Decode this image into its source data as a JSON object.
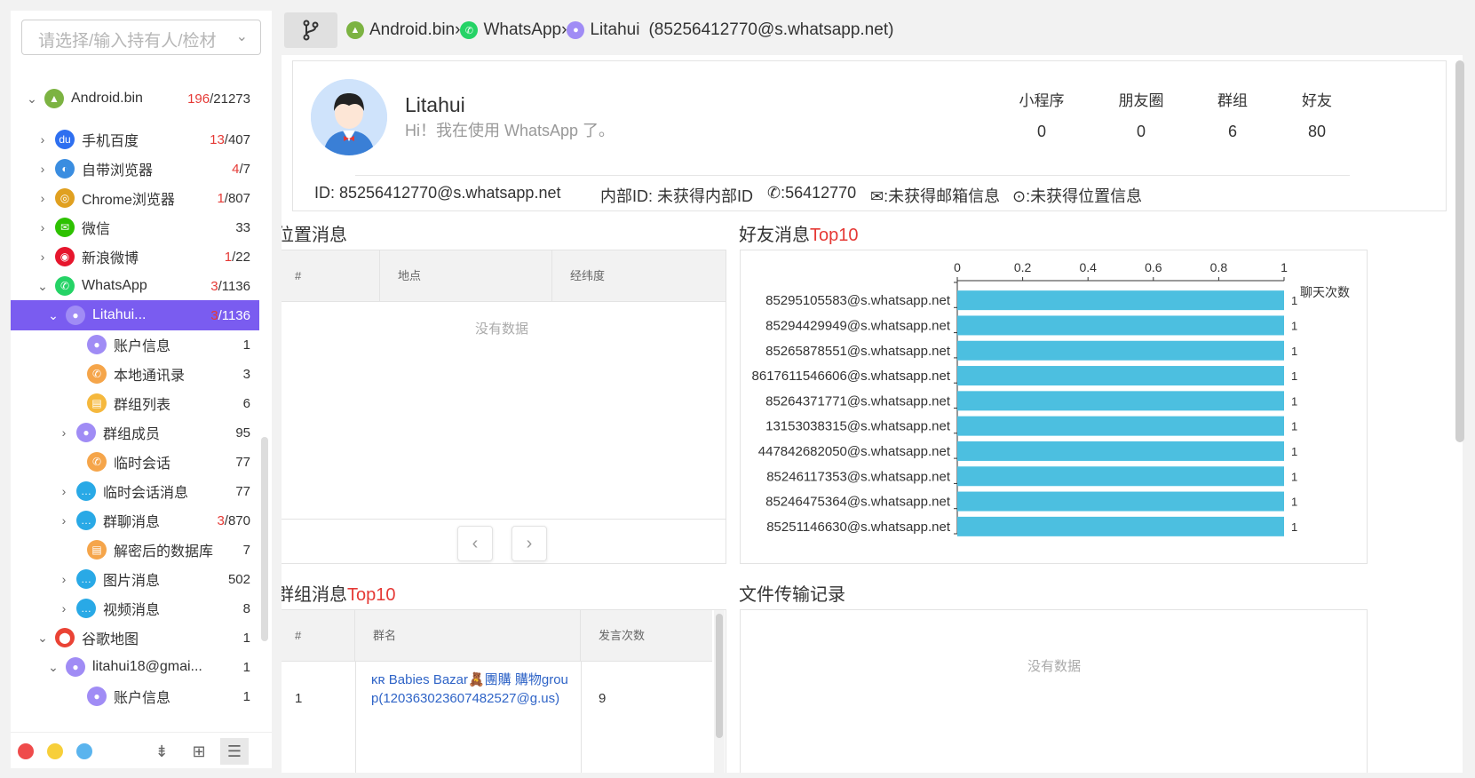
{
  "sidebar": {
    "search_placeholder": "请选择/输入持有人/检材",
    "tree": [
      {
        "label": "Android.bin",
        "count_red": "196",
        "count_total": "/21273",
        "arrow": "⌄",
        "icon": "android-icon",
        "color": "#7cb342"
      },
      {
        "label": "手机百度",
        "count_red": "13",
        "count_total": "/407",
        "arrow": "›",
        "icon": "baidu-icon",
        "color": "#2e6ff0"
      },
      {
        "label": "自带浏览器",
        "count_red": "4",
        "count_total": "/7",
        "arrow": "›",
        "icon": "browser-icon",
        "color": "#3a8de0"
      },
      {
        "label": "Chrome浏览器",
        "count_red": "1",
        "count_total": "/807",
        "arrow": "›",
        "icon": "chrome-icon",
        "color": "#e0a020"
      },
      {
        "label": "微信",
        "count_red": "",
        "count_total": "33",
        "arrow": "›",
        "icon": "wechat-icon",
        "color": "#2dc100"
      },
      {
        "label": "新浪微博",
        "count_red": "1",
        "count_total": "/22",
        "arrow": "›",
        "icon": "weibo-icon",
        "color": "#e6162d"
      },
      {
        "label": "WhatsApp",
        "count_red": "3",
        "count_total": "/1136",
        "arrow": "⌄",
        "icon": "whatsapp-icon",
        "color": "#25d366"
      },
      {
        "label": "Litahui...",
        "count_red": "3",
        "count_total": "/1136",
        "arrow": "⌄",
        "icon": "user-icon",
        "color": "#a08cf5"
      },
      {
        "label": "账户信息",
        "count_red": "",
        "count_total": "1",
        "arrow": "",
        "icon": "account-icon",
        "color": "#a08cf5"
      },
      {
        "label": "本地通讯录",
        "count_red": "",
        "count_total": "3",
        "arrow": "",
        "icon": "contacts-icon",
        "color": "#f5a54a"
      },
      {
        "label": "群组列表",
        "count_red": "",
        "count_total": "6",
        "arrow": "",
        "icon": "group-list-icon",
        "color": "#f5b83d"
      },
      {
        "label": "群组成员",
        "count_red": "",
        "count_total": "95",
        "arrow": "›",
        "icon": "group-member-icon",
        "color": "#a08cf5"
      },
      {
        "label": "临时会话",
        "count_red": "",
        "count_total": "77",
        "arrow": "",
        "icon": "temp-chat-icon",
        "color": "#f5a54a"
      },
      {
        "label": "临时会话消息",
        "count_red": "",
        "count_total": "77",
        "arrow": "›",
        "icon": "message-icon",
        "color": "#29a9e6"
      },
      {
        "label": "群聊消息",
        "count_red": "3",
        "count_total": "/870",
        "arrow": "›",
        "icon": "message-icon",
        "color": "#29a9e6"
      },
      {
        "label": "解密后的数据库",
        "count_red": "",
        "count_total": "7",
        "arrow": "",
        "icon": "database-icon",
        "color": "#f5a54a"
      },
      {
        "label": "图片消息",
        "count_red": "",
        "count_total": "502",
        "arrow": "›",
        "icon": "message-icon",
        "color": "#29a9e6"
      },
      {
        "label": "视频消息",
        "count_red": "",
        "count_total": "8",
        "arrow": "›",
        "icon": "message-icon",
        "color": "#29a9e6"
      },
      {
        "label": "谷歌地图",
        "count_red": "",
        "count_total": "1",
        "arrow": "⌄",
        "icon": "map-pin-icon",
        "color": "#ea4335"
      },
      {
        "label": "litahui18@gmai...",
        "count_red": "",
        "count_total": "1",
        "arrow": "⌄",
        "icon": "user-icon",
        "color": "#a08cf5"
      },
      {
        "label": "账户信息",
        "count_red": "",
        "count_total": "1",
        "arrow": "",
        "icon": "account-icon",
        "color": "#a08cf5"
      }
    ]
  },
  "breadcrumb": {
    "item1": "Android.bin",
    "item2": "WhatsApp",
    "item3": "Litahui",
    "item3_detail": "(85256412770@s.whatsapp.net)",
    "sep": "›"
  },
  "profile": {
    "name": "Litahui",
    "status": "Hi！我在使用 WhatsApp 了。",
    "stats": [
      {
        "label": "小程序",
        "value": "0"
      },
      {
        "label": "朋友圈",
        "value": "0"
      },
      {
        "label": "群组",
        "value": "6"
      },
      {
        "label": "好友",
        "value": "80"
      }
    ],
    "id_text": "ID: 85256412770@s.whatsapp.net",
    "internal_id": "内部ID: 未获得内部ID",
    "phone": ":56412770",
    "email": ":未获得邮箱信息",
    "location": ":未获得位置信息"
  },
  "location_section": {
    "title": "位置消息",
    "columns": [
      "#",
      "地点",
      "经纬度"
    ],
    "empty": "没有数据"
  },
  "friends_section": {
    "title_main": "好友消息",
    "title_accent": "Top10"
  },
  "group_section": {
    "title_main": "群组消息",
    "title_accent": "Top10",
    "columns": [
      "#",
      "群名",
      "发言次数"
    ],
    "rows": [
      {
        "idx": "1",
        "name": "ĸʀ Babies Bazar🧸團購 購物group(120363023607482527@g.us)",
        "count": "9"
      }
    ]
  },
  "file_section": {
    "title": "文件传输记录",
    "empty": "没有数据"
  },
  "colors": {
    "accent": "#7a5cf0",
    "bar": "#4cbfe0",
    "red": "#e53935"
  },
  "chart_data": {
    "type": "bar",
    "orientation": "horizontal",
    "xlabel": "聊天次数",
    "xlim": [
      0,
      1
    ],
    "xticks": [
      "0",
      "0.2",
      "0.4",
      "0.6",
      "0.8",
      "1"
    ],
    "categories": [
      "85295105583@s.whatsapp.net",
      "85294429949@s.whatsapp.net",
      "85265878551@s.whatsapp.net",
      "8617611546606@s.whatsapp.net",
      "85264371771@s.whatsapp.net",
      "13153038315@s.whatsapp.net",
      "447842682050@s.whatsapp.net",
      "85246117353@s.whatsapp.net",
      "85246475364@s.whatsapp.net",
      "85251146630@s.whatsapp.net"
    ],
    "values": [
      1,
      1,
      1,
      1,
      1,
      1,
      1,
      1,
      1,
      1
    ],
    "value_labels": [
      "1",
      "1",
      "1",
      "1",
      "1",
      "1",
      "1",
      "1",
      "1",
      "1"
    ],
    "grid": false
  }
}
